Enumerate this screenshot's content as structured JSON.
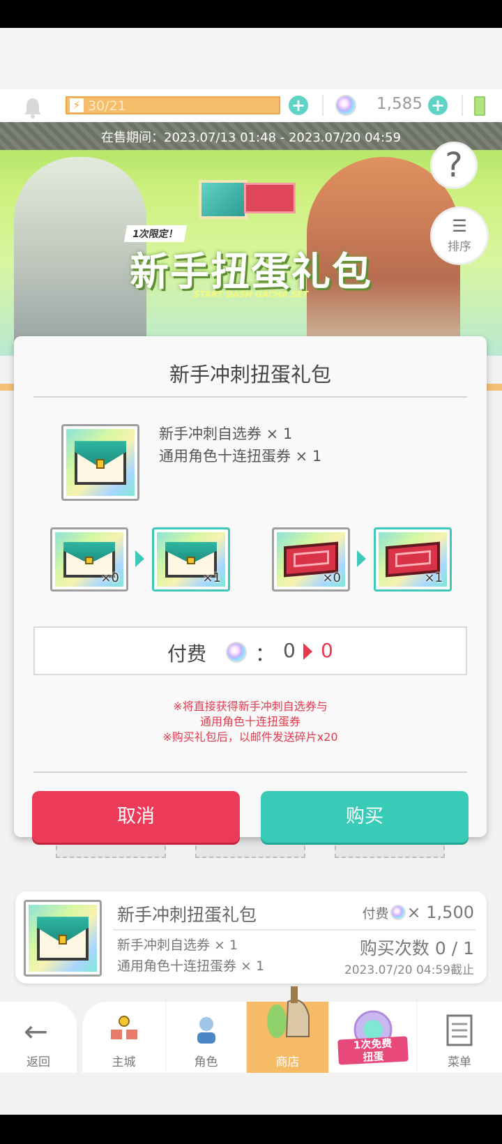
{
  "status": {
    "stamina": "30/21",
    "gems": "1,585"
  },
  "banner": {
    "sale_period": "在售期间：2023.07/13 01:48 - 2023.07/20 04:59",
    "limit_tag": "1次限定！",
    "title": "新手扭蛋礼包",
    "subtitle": "START DASH GACHA SET",
    "help": "?",
    "sort": "排序"
  },
  "dialog": {
    "title": "新手冲刺扭蛋礼包",
    "contents": [
      "新手冲刺自选券 × 1",
      "通用角色十连扭蛋券 × 1"
    ],
    "conversions": [
      {
        "from": "×0",
        "to": "×1"
      },
      {
        "from": "×0",
        "to": "×1"
      }
    ],
    "price_label": "付费",
    "price_colon": "：",
    "price_old": "0",
    "price_new": "0",
    "notes": [
      "※将直接获得新手冲刺自选券与",
      "通用角色十连扭蛋券",
      "※购买礼包后，以邮件发送碎片x20"
    ],
    "cancel": "取消",
    "buy": "购买"
  },
  "product": {
    "title": "新手冲刺扭蛋礼包",
    "lines": [
      "新手冲刺自选券 × 1",
      "通用角色十连扭蛋券 × 1"
    ],
    "cost_label": "付费",
    "cost": "× 1,500",
    "purchase_count": "购买次数 0 / 1",
    "deadline": "2023.07/20 04:59截止"
  },
  "nav": {
    "back": "返回",
    "items": [
      "主城",
      "角色",
      "商店",
      "",
      "菜单"
    ],
    "free_badge_line1": "1次免费",
    "free_badge_line2": "扭蛋"
  },
  "colors": {
    "accent_teal": "#37cbb8",
    "cancel_red": "#ec3b58",
    "active_tab": "#f5bb66"
  }
}
